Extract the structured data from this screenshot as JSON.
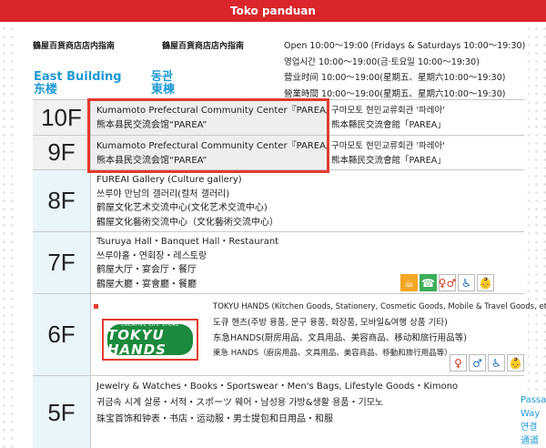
{
  "topbar": {
    "title": "Toko panduan"
  },
  "header": {
    "guide_left": "鶴屋百貨商店店内指南",
    "guide_right": "鶴屋百貨商店店內指南",
    "hours": [
      "Open 10:00～19:00 (Fridays & Saturdays 10:00～19:30)",
      "영업시간 10:00～19:00(금·토요일 10:00～19:30)",
      "营业时间 10:00～19:00(星期五、星期六10:00～19:30)",
      "營業時間 10:00～19:00(星期五、星期六10:00～19:30)"
    ]
  },
  "building": {
    "en": "East Building",
    "zh_s": "东楼",
    "ko": "동관",
    "zh_t": "東棟"
  },
  "floors": [
    {
      "floor": "10F",
      "main": [
        "Kumamoto Prefectural Community Center『PAREA』",
        "熊本县民交流会馆“PAREA”"
      ],
      "side": [
        "구마모토 현민교류회관 '파레아'",
        "熊本縣民交流會館「PAREA」"
      ]
    },
    {
      "floor": "9F",
      "main": [
        "Kumamoto Prefectural Community Center『PAREA』",
        "熊本县民交流会馆“PAREA”"
      ],
      "side": [
        "구마모토 현민교류회관 '파레아'",
        "熊本縣民交流會館「PAREA」"
      ]
    },
    {
      "floor": "8F",
      "main": [
        "FUREAI Gallery (Culture gallery)",
        "쓰루야 만남의 갤러리(컬처 갤러리)",
        "鹤屋文化艺术交流中心(文化艺术交流中心)",
        "鶴屋文化藝術交流中心（文化藝術交流中心）"
      ]
    },
    {
      "floor": "7F",
      "main": [
        "Tsuruya Hall・Banquet Hall・Restaurant",
        "쓰루야홀・연회장・레스토랑",
        "鹤屋大厅・宴会厅・餐厅",
        "鶴屋大廳・宴會廳・餐廳"
      ]
    },
    {
      "floor": "6F",
      "logo_small": "CREATIVE LIFE STORE",
      "logo_big": "TOKYU HANDS",
      "main": [
        "TOKYU HANDS (Kitchen Goods, Stationery, Cosmetic Goods, Mobile & Travel Goods, etc.)",
        "도큐 핸즈(주방 용품, 문구 용품, 화장품, 모바일&여행 상품 기타)",
        "东急HANDS(厨房用品、文具用品、美容商品、移动和旅行用品等)",
        "東急 HANDS（廚房用品、文具用品、美容商品、移動和旅行用品等）"
      ]
    },
    {
      "floor": "5F",
      "main": [
        "Jewelry & Watches・Books・Sportswear・Men's Bags, Lifestyle Goods・Kimono",
        "귀금속 시계 살롱・서적・スポーツ 웨어・남성용 가방&생활 용품・기모노",
        "珠宝首饰和钟表・书店・运动服・男士提包和日用品・和服"
      ]
    }
  ],
  "passage": [
    "Passa",
    "Way",
    "연결",
    "通道"
  ],
  "icons": {
    "7F": [
      "cafe-icon",
      "phone-icon",
      "restroom-icon",
      "wheelchair-icon",
      "baby-care-icon"
    ],
    "6F": [
      "restroom-icon",
      "restroom-icon",
      "wheelchair-icon",
      "baby-care-icon"
    ]
  },
  "colors": {
    "accent_red": "#d9252b",
    "accent_blue": "#1f9ad6",
    "hands_green": "#1b8a3c"
  }
}
